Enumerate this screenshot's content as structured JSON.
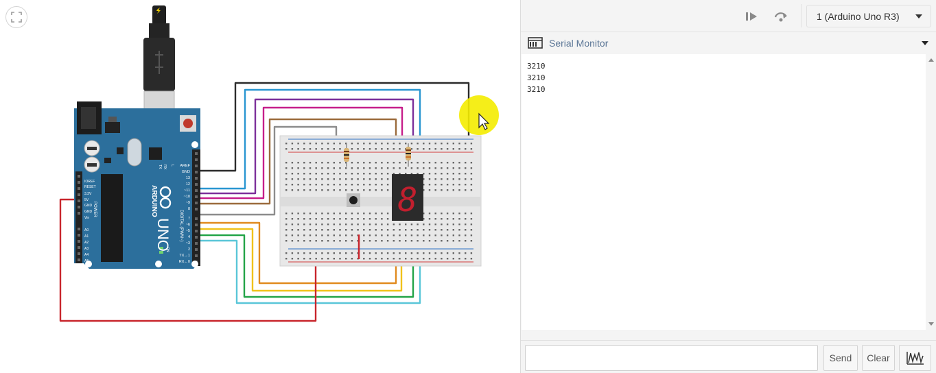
{
  "toolbar": {
    "step_icon": "play-step-icon",
    "step_over_icon": "step-over-icon",
    "device_label": "1 (Arduino Uno R3)"
  },
  "serial_monitor": {
    "title": "Serial Monitor",
    "lines": [
      "3210",
      "3210",
      "3210"
    ],
    "input_value": "",
    "send_label": "Send",
    "clear_label": "Clear",
    "graph_icon": "graph-icon"
  },
  "board": {
    "name": "ARDUINO",
    "model": "UNO",
    "digital_label": "DIGITAL (PWM~)",
    "power_label": "POWER",
    "pins_top": [
      "AREF",
      "GND",
      "13",
      "12",
      "~11",
      "~10",
      "~9",
      "8"
    ],
    "pins_bottom": [
      "7",
      "~6",
      "~5",
      "4",
      "~3",
      "2",
      "TX→1",
      "RX←0"
    ],
    "pins_left": [
      "IOREF",
      "RESET",
      "3.3V",
      "5V",
      "GND",
      "GND",
      "Vin"
    ],
    "pins_analog": [
      "A0",
      "A1",
      "A2",
      "A3",
      "A4",
      "A5"
    ],
    "led_labels": [
      "TX",
      "RX",
      "L",
      "ON"
    ]
  },
  "display": {
    "digit": "8"
  },
  "colors": {
    "accent_link": "#5b7696",
    "board_blue": "#2c6f9c",
    "segment_red": "#c21f2e",
    "cursor_highlight": "#f4ec00"
  }
}
